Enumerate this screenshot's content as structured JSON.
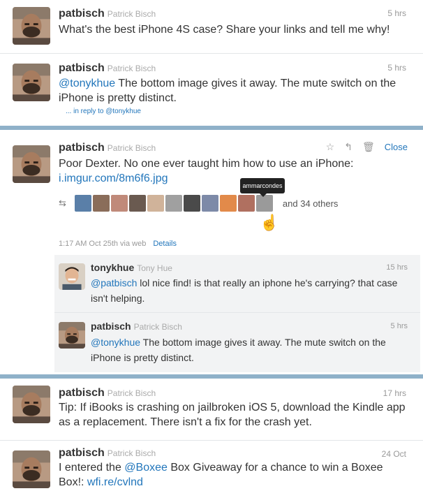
{
  "tweets": [
    {
      "username": "patbisch",
      "fullname": "Patrick Bisch",
      "time": "5 hrs",
      "text": "What's the best iPhone 4S case? Share your links and tell me why!"
    },
    {
      "username": "patbisch",
      "fullname": "Patrick Bisch",
      "time": "5 hrs",
      "mention": "@tonykhue",
      "text": " The bottom image gives it away. The mute switch on the iPhone is pretty distinct.",
      "in_reply": "... in reply to @tonykhue"
    },
    {
      "username": "patbisch",
      "fullname": "Patrick Bisch",
      "text": "Poor Dexter. No one ever taught him how to use an iPhone:",
      "link": "i.imgur.com/8m6f6.jpg",
      "close_label": "Close",
      "others_label": "and 34 others",
      "tooltip": "ammarcondes",
      "meta": "1:17 AM Oct 25th via web",
      "details_label": "Details"
    },
    {
      "username": "patbisch",
      "fullname": "Patrick Bisch",
      "time": "17 hrs",
      "text": "Tip: If iBooks is crashing on jailbroken iOS 5, download the Kindle app as a replacement. There isn't a fix for the crash yet."
    },
    {
      "username": "patbisch",
      "fullname": "Patrick Bisch",
      "time": "24 Oct",
      "text_before": "I entered the ",
      "mention": "@Boxee",
      "text_after": " Box Giveaway for a chance to win a Boxee Box!:",
      "link": "wfi.re/cvlnd"
    }
  ],
  "replies": [
    {
      "username": "tonykhue",
      "fullname": "Tony Hue",
      "time": "15 hrs",
      "mention": "@patbisch",
      "text": " lol nice find! is that really an iphone he's carrying? that case isn't helping."
    },
    {
      "username": "patbisch",
      "fullname": "Patrick Bisch",
      "time": "5 hrs",
      "mention": "@tonykhue",
      "text": " The bottom image gives it away. The mute switch on the iPhone is pretty distinct."
    }
  ],
  "colors": {
    "link": "#2276bb",
    "separator": "#8fb1c9",
    "reply_bg": "#f2f3f4"
  },
  "icons": [
    "star-icon",
    "reply-icon",
    "trash-icon",
    "retweet-icon",
    "hand-cursor-icon"
  ]
}
